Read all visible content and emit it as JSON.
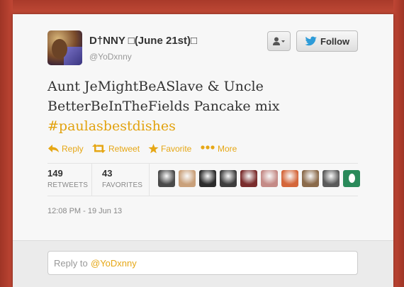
{
  "user": {
    "display_name": "D†NNY □(June 21st)□",
    "handle": "@YoDxnny"
  },
  "buttons": {
    "follow_label": "Follow"
  },
  "tweet": {
    "text": "Aunt JeMightBeASlave & Uncle BetterBeInTheFields Pancake mix",
    "hashtag": "#paulasbestdishes"
  },
  "actions": {
    "reply": "Reply",
    "retweet": "Retweet",
    "favorite": "Favorite",
    "more": "More"
  },
  "stats": {
    "retweets_count": "149",
    "retweets_label": "RETWEETS",
    "favorites_count": "43",
    "favorites_label": "FAVORITES"
  },
  "favoriter_avatar_colors": [
    "#4a4a4a",
    "#c9a07a",
    "#2b2b2b",
    "#3d3d3d",
    "#7a2d2d",
    "#c48a86",
    "#d4663a",
    "#8a6a4a",
    "#5a5a5a",
    "#2a8a5a"
  ],
  "timestamp": "12:08 PM - 19 Jun 13",
  "reply": {
    "prefix": "Reply to",
    "mention": "@YoDxnny"
  },
  "colors": {
    "accent": "#e6a715",
    "link_blue": "#2d9bd8",
    "background": "#b8412f"
  },
  "icons": [
    "user-dropdown-icon",
    "twitter-bird-icon",
    "reply-icon",
    "retweet-icon",
    "star-icon",
    "more-dots-icon"
  ]
}
